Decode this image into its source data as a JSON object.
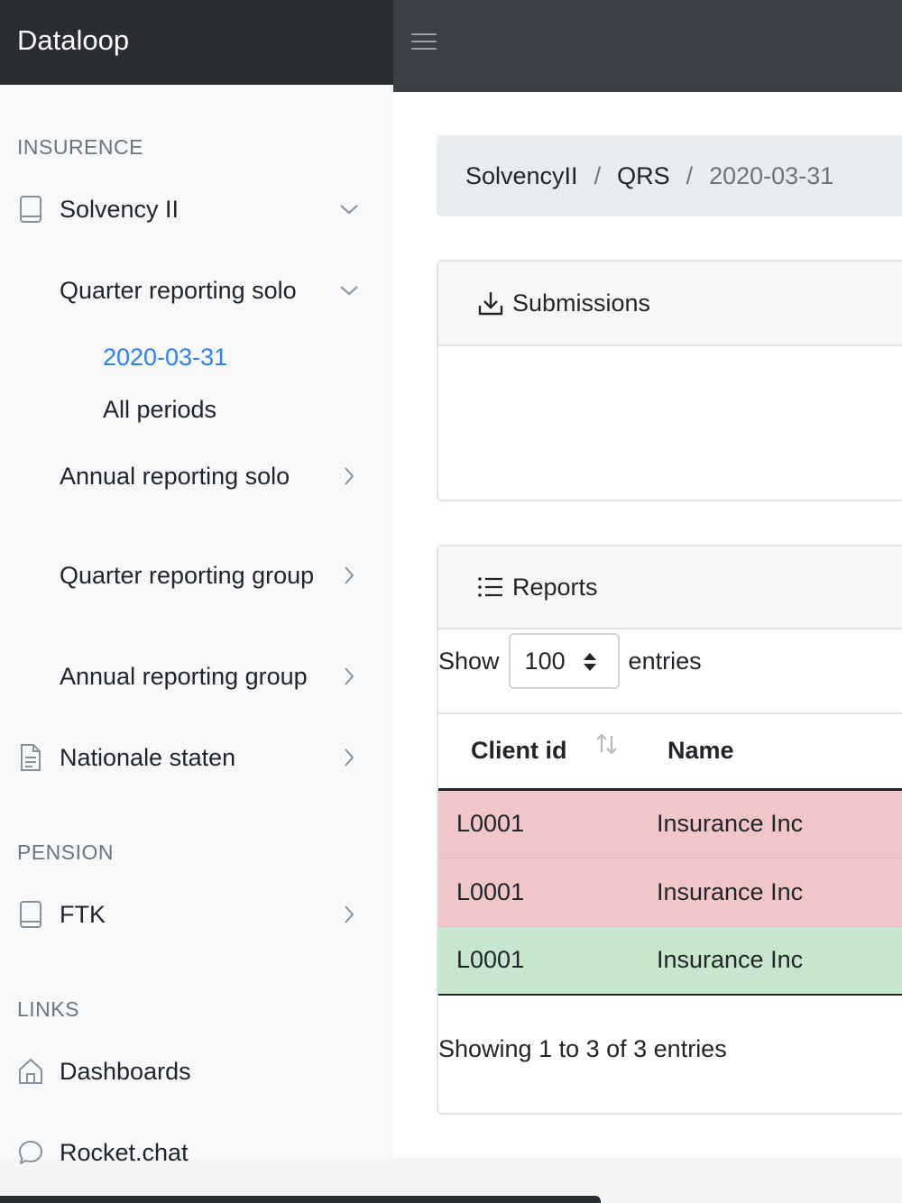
{
  "app": {
    "brand": "Dataloop"
  },
  "sidebar": {
    "sections": [
      {
        "label": "INSURENCE"
      },
      {
        "label": "PENSION"
      },
      {
        "label": "LINKS"
      }
    ],
    "items": {
      "solvency": "Solvency II",
      "quarter_solo": "Quarter reporting solo",
      "period_current": "2020-03-31",
      "all_periods": "All periods",
      "annual_solo": "Annual reporting solo",
      "quarter_group": "Quarter reporting group",
      "annual_group": "Annual reporting group",
      "nationale": "Nationale staten",
      "ftk": "FTK",
      "dashboards": "Dashboards",
      "rocket": "Rocket.chat"
    },
    "icons": {
      "book": "book-icon",
      "document": "document-icon",
      "home": "home-icon",
      "chat": "chat-icon",
      "chevron_down": "chevron-down-icon",
      "chevron_right": "chevron-right-icon"
    }
  },
  "breadcrumb": [
    "SolvencyII",
    "QRS",
    "2020-03-31"
  ],
  "submissions": {
    "title": "Submissions",
    "icon": "download-icon"
  },
  "reports": {
    "title": "Reports",
    "icon": "list-icon",
    "length": {
      "prefix": "Show",
      "value": "100",
      "suffix": "entries"
    },
    "columns": [
      "Client id",
      "Name"
    ],
    "rows": [
      {
        "client_id": "L0001",
        "name": "Insurance Inc",
        "status": "danger"
      },
      {
        "client_id": "L0001",
        "name": "Insurance Inc",
        "status": "danger"
      },
      {
        "client_id": "L0001",
        "name": "Insurance Inc",
        "status": "success"
      }
    ],
    "info": "Showing 1 to 3 of 3 entries"
  },
  "colors": {
    "accent": "#2f80ed",
    "row_danger": "#f0c6c9",
    "row_success": "#c8e5cd",
    "brand_bg": "#2a2d32",
    "topbar_bg": "#3c4046"
  }
}
